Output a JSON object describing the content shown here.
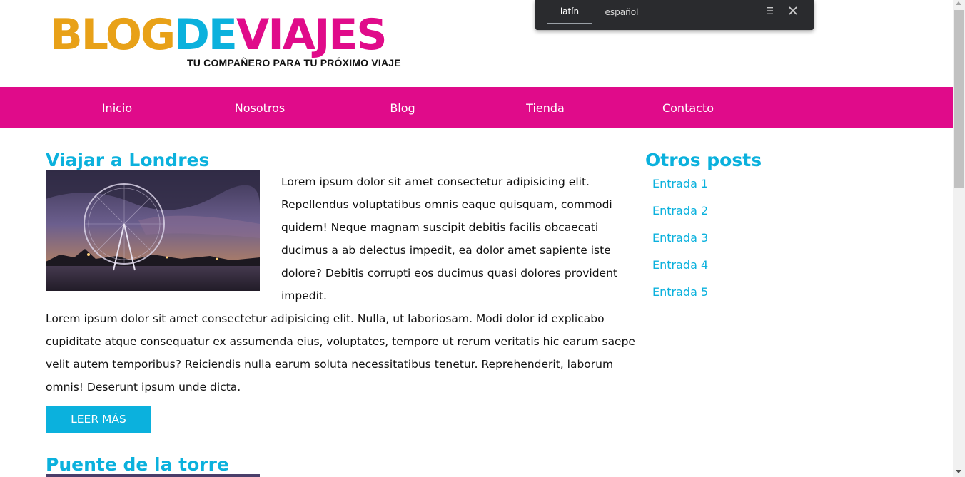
{
  "logo": {
    "part1": "BLOG",
    "part2": "DE",
    "part3": "VIAJES",
    "tagline": "TU COMPAÑERO PARA TU PRÓXIMO VIAJE"
  },
  "translate": {
    "source_lang": "latín",
    "target_lang": "español",
    "menu_icon": "menu-icon",
    "close_icon": "close-icon"
  },
  "nav": {
    "items": [
      {
        "label": "Inicio"
      },
      {
        "label": "Nosotros"
      },
      {
        "label": "Blog"
      },
      {
        "label": "Tienda"
      },
      {
        "label": "Contacto"
      }
    ]
  },
  "posts": [
    {
      "title": "Viajar a Londres",
      "paragraph1": "Lorem ipsum dolor sit amet consectetur adipisicing elit. Repellendus voluptatibus omnis eaque quisquam, commodi quidem! Neque magnam suscipit debitis facilis obcaecati ducimus a ab delectus impedit, ea dolor amet sapiente iste dolore? Debitis corrupti eos ducimus quasi dolores provident impedit.",
      "paragraph2": "Lorem ipsum dolor sit amet consectetur adipisicing elit. Nulla, ut laboriosam. Modi dolor id explicabo cupiditate atque consequatur ex assumenda eius, voluptates, tempore ut rerum veritatis hic earum saepe velit autem temporibus? Reiciendis nulla earum soluta necessitatibus tenetur. Reprehenderit, laborum omnis! Deserunt ipsum unde dicta.",
      "button": "LEER MÁS"
    },
    {
      "title": "Puente de la torre"
    }
  ],
  "sidebar": {
    "title": "Otros posts",
    "links": [
      {
        "label": "Entrada 1"
      },
      {
        "label": "Entrada 2"
      },
      {
        "label": "Entrada 3"
      },
      {
        "label": "Entrada 4"
      },
      {
        "label": "Entrada 5"
      }
    ]
  },
  "colors": {
    "brand_pink": "#e00b8a",
    "brand_blue": "#0bb1dd",
    "brand_orange": "#e8a118"
  }
}
